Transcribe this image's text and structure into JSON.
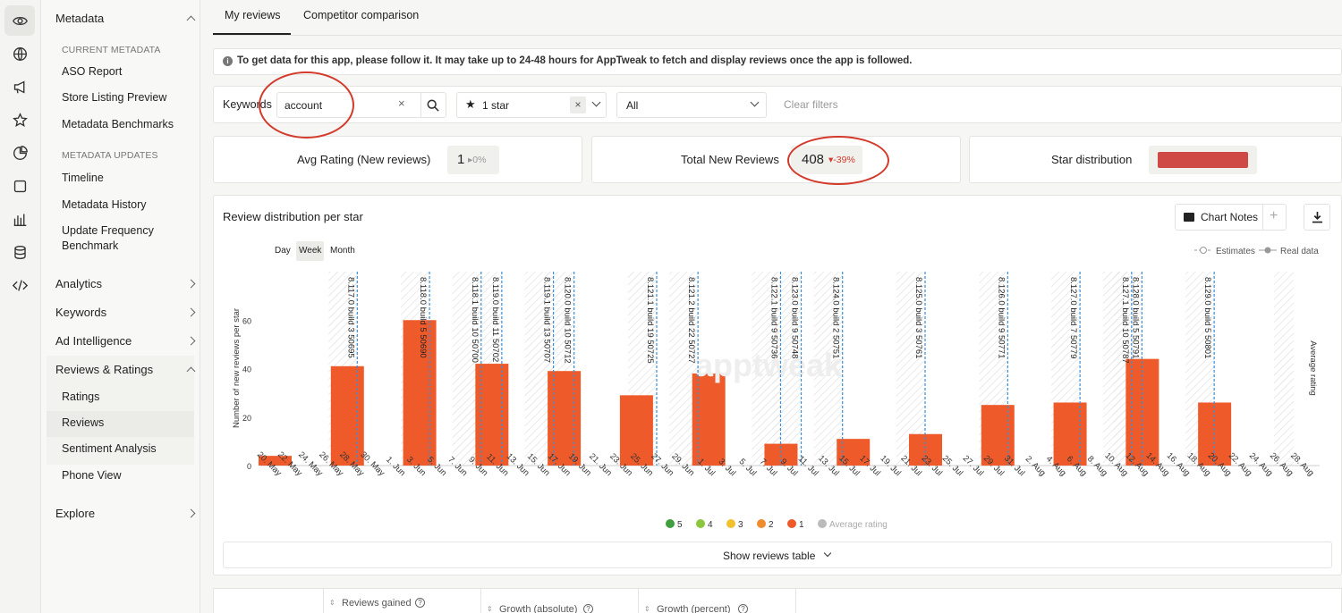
{
  "rail_icons": [
    "eye-icon",
    "globe-icon",
    "megaphone-icon",
    "star-icon",
    "pie-chart-icon",
    "square-icon",
    "bar-chart-icon",
    "database-icon",
    "code-icon"
  ],
  "sidebar": {
    "metadata": "Metadata",
    "current_metadata": "CURRENT METADATA",
    "aso_report": "ASO Report",
    "store_listing_preview": "Store Listing Preview",
    "metadata_benchmarks": "Metadata Benchmarks",
    "metadata_updates": "METADATA UPDATES",
    "timeline": "Timeline",
    "metadata_history": "Metadata History",
    "update_frequency_1": "Update Frequency",
    "update_frequency_2": "Benchmark",
    "analytics": "Analytics",
    "keywords": "Keywords",
    "ad_intelligence": "Ad Intelligence",
    "reviews_ratings": "Reviews & Ratings",
    "ratings": "Ratings",
    "reviews": "Reviews",
    "sentiment_analysis": "Sentiment Analysis",
    "phone_view": "Phone View",
    "explore": "Explore"
  },
  "tabs": {
    "my_reviews": "My reviews",
    "competitor": "Competitor comparison"
  },
  "info": "To get data for this app, please follow it. It may take up to 24-48 hours for AppTweak to fetch and display reviews once the app is followed.",
  "filters": {
    "keywords_label": "Keywords",
    "keyword_value": "account",
    "clear_x": "×",
    "star_value": "1 star",
    "star_glyph": "★",
    "second_value": "All",
    "clear_filters": "Clear filters"
  },
  "stats": {
    "avg_label": "Avg Rating (New reviews)",
    "avg_value": "1",
    "avg_change": "▸0%",
    "total_label": "Total New Reviews",
    "total_value": "408",
    "total_change": "▾-39%",
    "dist_label": "Star distribution",
    "dist_color": "#cf4a45"
  },
  "chart_card": {
    "title": "Review distribution per star",
    "notes": "Chart Notes",
    "plus": "+",
    "day": "Day",
    "week": "Week",
    "month": "Month",
    "legend_estimates": "Estimates",
    "legend_real": "Real data",
    "show_table": "Show reviews table",
    "watermark": "apptweak"
  },
  "chart_data": {
    "type": "bar",
    "ylabel": "Number of new reviews per star",
    "y2label": "Average rating",
    "ylim": [
      0,
      80
    ],
    "yticks": [
      0,
      20,
      40,
      60
    ],
    "bar_color": "#ee5a2a",
    "x_ticks": [
      "20. May",
      "22. May",
      "24. May",
      "26. May",
      "28. May",
      "30. May",
      "1. Jun",
      "3. Jun",
      "5. Jun",
      "7. Jun",
      "9. Jun",
      "11. Jun",
      "13. Jun",
      "15. Jun",
      "17. Jun",
      "19. Jun",
      "21. Jun",
      "23. Jun",
      "25. Jun",
      "27. Jun",
      "29. Jun",
      "1. Jul",
      "3. Jul",
      "5. Jul",
      "7. Jul",
      "9. Jul",
      "11. Jul",
      "13. Jul",
      "15. Jul",
      "17. Jul",
      "19. Jul",
      "21. Jul",
      "23. Jul",
      "25. Jul",
      "27. Jul",
      "29. Jul",
      "31. Jul",
      "2. Aug",
      "4. Aug",
      "6. Aug",
      "8. Aug",
      "10. Aug",
      "12. Aug",
      "14. Aug",
      "16. Aug",
      "18. Aug",
      "20. Aug",
      "22. Aug",
      "24. Aug",
      "26. Aug",
      "28. Aug"
    ],
    "bars": [
      {
        "x": "20. May",
        "value": 4
      },
      {
        "x": "27. May",
        "value": 41
      },
      {
        "x": "3. Jun",
        "value": 60
      },
      {
        "x": "10. Jun",
        "value": 42
      },
      {
        "x": "17. Jun",
        "value": 39
      },
      {
        "x": "24. Jun",
        "value": 29
      },
      {
        "x": "1. Jul",
        "value": 38
      },
      {
        "x": "8. Jul",
        "value": 9
      },
      {
        "x": "15. Jul",
        "value": 11
      },
      {
        "x": "22. Jul",
        "value": 13
      },
      {
        "x": "29. Jul",
        "value": 25
      },
      {
        "x": "5. Aug",
        "value": 26
      },
      {
        "x": "12. Aug",
        "value": 44
      },
      {
        "x": "19. Aug",
        "value": 26
      }
    ],
    "versions": [
      {
        "x": "28. May",
        "label": "8.117.0 build 3 50695"
      },
      {
        "x": "4. Jun",
        "label": "8.118.0 build 5 50690"
      },
      {
        "x": "9. Jun",
        "label": "8.118.1 build 10 50700"
      },
      {
        "x": "11. Jun",
        "label": "8.119.0 build 11 50702"
      },
      {
        "x": "16. Jun",
        "label": "8.119.1 build 13 50707"
      },
      {
        "x": "18. Jun",
        "label": "8.120.0 build 10 50712"
      },
      {
        "x": "26. Jun",
        "label": "8.121.1 build 19 50725"
      },
      {
        "x": "30. Jun",
        "label": "8.121.2 build 22 50727"
      },
      {
        "x": "8. Jul",
        "label": "8.122.1 build 9 50736"
      },
      {
        "x": "10. Jul",
        "label": "8.123.0 build 9 50748"
      },
      {
        "x": "14. Jul",
        "label": "8.124.0 build 2 50751"
      },
      {
        "x": "22. Jul",
        "label": "8.125.0 build 3 50761"
      },
      {
        "x": "30. Jul",
        "label": "8.126.0 build 9 50771"
      },
      {
        "x": "6. Aug",
        "label": "8.127.0 build 7 50779"
      },
      {
        "x": "11. Aug",
        "label": "8.127.1 build 10 50787"
      },
      {
        "x": "12. Aug",
        "label": "8.128.0 build 5 50791"
      },
      {
        "x": "19. Aug",
        "label": "8.129.0 build 5 50801"
      }
    ],
    "legend": [
      {
        "name": "5",
        "color": "#3f9e3f"
      },
      {
        "name": "4",
        "color": "#8cc63e"
      },
      {
        "name": "3",
        "color": "#f2c12e"
      },
      {
        "name": "2",
        "color": "#f08c2e"
      },
      {
        "name": "1",
        "color": "#ee5a2a"
      },
      {
        "name": "Average rating",
        "color": "#bbbbbb"
      }
    ]
  },
  "table_headers": {
    "reviews_gained": "Reviews gained",
    "growth_absolute": "Growth (absolute)",
    "growth_percent": "Growth (percent)",
    "q": "?",
    "sort": "⇕"
  }
}
